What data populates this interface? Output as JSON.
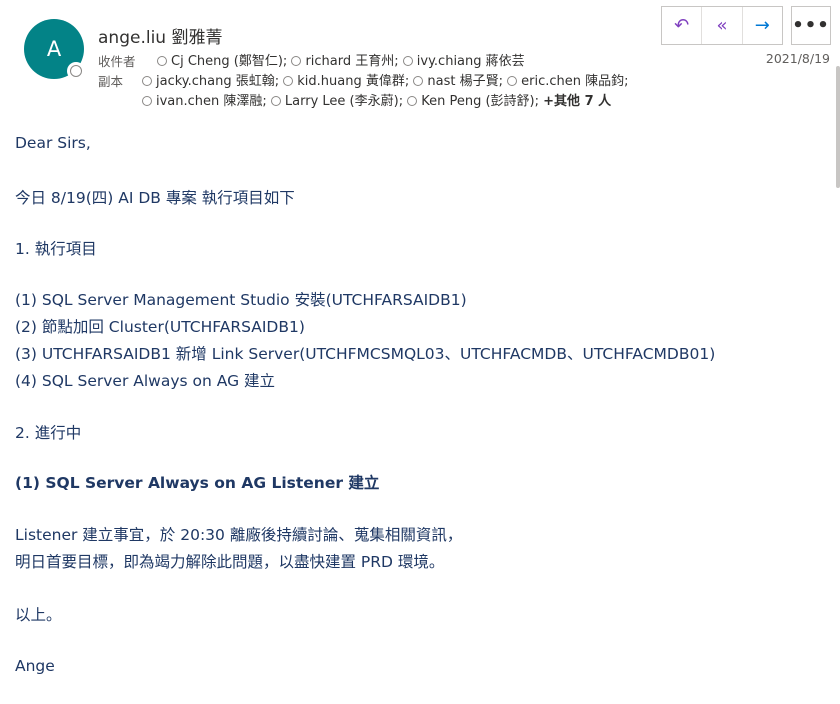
{
  "sender": {
    "initial": "A",
    "name": "ange.liu 劉雅菁"
  },
  "recipients": {
    "to_label": "收件者",
    "to": [
      "Cj Cheng (鄭智仁);",
      "richard 王育州;",
      "ivy.chiang 蔣依芸"
    ],
    "cc_label": "副本",
    "cc_line1": [
      "jacky.chang 張虹翰;",
      "kid.huang 黃偉群;",
      "nast 楊子賢;",
      "eric.chen 陳品鈞;"
    ],
    "cc_line2": [
      "ivan.chen 陳澤融;",
      "Larry Lee (李永蔚);",
      "Ken Peng (彭詩舒);"
    ],
    "more": "+其他 7 人"
  },
  "date": "2021/8/19",
  "actions": {
    "reply_icon": "reply-icon",
    "reply_all_icon": "reply-all-icon",
    "forward_icon": "forward-icon",
    "more_icon": "more-icon",
    "reply_glyph": "↶",
    "reply_all_glyph": "«",
    "forward_glyph": "→",
    "more_glyph": "•••"
  },
  "colors": {
    "avatar_bg": "#038387",
    "body_text": "#1f3864",
    "action_icon": "#7f3fbf",
    "forward_icon": "#0078d4"
  },
  "body": {
    "greeting": "Dear Sirs,",
    "intro": "今日 8/19(四) AI DB 專案 執行項目如下",
    "section1": "1.   執行項目",
    "items": [
      "(1)  SQL Server Management Studio 安裝(UTCHFARSAIDB1)",
      "(2)  節點加回 Cluster(UTCHFARSAIDB1)",
      "(3)  UTCHFARSAIDB1 新增 Link Server(UTCHFMCSMQL03、UTCHFACMDB、UTCHFACMDB01)",
      "(4)  SQL Server Always on AG 建立"
    ],
    "section2": "2.   進行中",
    "in_progress": "(1) SQL Server Always on AG Listener 建立",
    "note_line1": "Listener 建立事宜，於 20:30 離廠後持續討論、蒐集相關資訊，",
    "note_line2": "明日首要目標，即為竭力解除此問題，以盡快建置 PRD 環境。",
    "closing": "以上。",
    "signature": "Ange"
  }
}
